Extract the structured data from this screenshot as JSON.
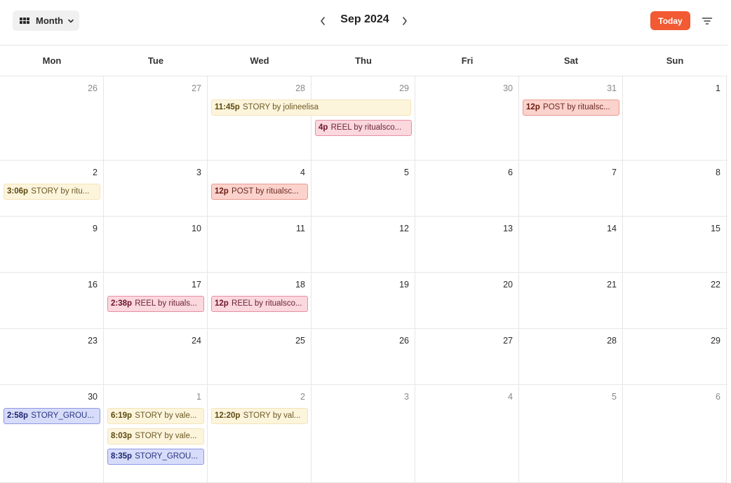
{
  "toolbar": {
    "view_label": "Month",
    "month_title": "Sep 2024",
    "today_label": "Today",
    "icons": {
      "view": "grid-icon",
      "view_dropdown": "chevron-down-icon",
      "prev": "chevron-left-icon",
      "next": "chevron-right-icon",
      "filter": "filter-icon"
    },
    "accent_color": "#f25a33"
  },
  "weekdays": [
    "Mon",
    "Tue",
    "Wed",
    "Thu",
    "Fri",
    "Sat",
    "Sun"
  ],
  "weeks": [
    {
      "days": [
        {
          "num": "26",
          "muted": true,
          "events": []
        },
        {
          "num": "27",
          "muted": true,
          "events": []
        },
        {
          "num": "28",
          "muted": true,
          "events": [
            {
              "time": "11:45p",
              "text": "STORY by jolineelisa",
              "kind": "story",
              "wide": true
            }
          ]
        },
        {
          "num": "29",
          "muted": true,
          "events": [
            {
              "time": "4p",
              "text": "REEL by ritualsco...",
              "kind": "reel"
            }
          ]
        },
        {
          "num": "30",
          "muted": true,
          "events": []
        },
        {
          "num": "31",
          "muted": true,
          "events": [
            {
              "time": "12p",
              "text": "POST by ritualsc...",
              "kind": "post"
            }
          ]
        },
        {
          "num": "1",
          "muted": false,
          "events": []
        }
      ]
    },
    {
      "days": [
        {
          "num": "2",
          "muted": false,
          "events": [
            {
              "time": "3:06p",
              "text": "STORY by ritu...",
              "kind": "story"
            }
          ]
        },
        {
          "num": "3",
          "muted": false,
          "events": []
        },
        {
          "num": "4",
          "muted": false,
          "events": [
            {
              "time": "12p",
              "text": "POST by ritualsc...",
              "kind": "post"
            }
          ]
        },
        {
          "num": "5",
          "muted": false,
          "events": []
        },
        {
          "num": "6",
          "muted": false,
          "events": []
        },
        {
          "num": "7",
          "muted": false,
          "events": []
        },
        {
          "num": "8",
          "muted": false,
          "events": []
        }
      ]
    },
    {
      "days": [
        {
          "num": "9",
          "muted": false,
          "events": []
        },
        {
          "num": "10",
          "muted": false,
          "events": []
        },
        {
          "num": "11",
          "muted": false,
          "events": []
        },
        {
          "num": "12",
          "muted": false,
          "events": []
        },
        {
          "num": "13",
          "muted": false,
          "events": []
        },
        {
          "num": "14",
          "muted": false,
          "events": []
        },
        {
          "num": "15",
          "muted": false,
          "events": []
        }
      ]
    },
    {
      "days": [
        {
          "num": "16",
          "muted": false,
          "events": []
        },
        {
          "num": "17",
          "muted": false,
          "events": [
            {
              "time": "2:38p",
              "text": "REEL by rituals...",
              "kind": "reel"
            }
          ]
        },
        {
          "num": "18",
          "muted": false,
          "events": [
            {
              "time": "12p",
              "text": "REEL by ritualsco...",
              "kind": "reel"
            }
          ]
        },
        {
          "num": "19",
          "muted": false,
          "events": []
        },
        {
          "num": "20",
          "muted": false,
          "events": []
        },
        {
          "num": "21",
          "muted": false,
          "events": []
        },
        {
          "num": "22",
          "muted": false,
          "events": []
        }
      ]
    },
    {
      "days": [
        {
          "num": "23",
          "muted": false,
          "events": []
        },
        {
          "num": "24",
          "muted": false,
          "events": []
        },
        {
          "num": "25",
          "muted": false,
          "events": []
        },
        {
          "num": "26",
          "muted": false,
          "events": []
        },
        {
          "num": "27",
          "muted": false,
          "events": []
        },
        {
          "num": "28",
          "muted": false,
          "events": []
        },
        {
          "num": "29",
          "muted": false,
          "events": []
        }
      ]
    },
    {
      "days": [
        {
          "num": "30",
          "muted": false,
          "events": [
            {
              "time": "2:58p",
              "text": "STORY_GROU...",
              "kind": "group"
            }
          ]
        },
        {
          "num": "1",
          "muted": true,
          "events": [
            {
              "time": "6:19p",
              "text": "STORY by vale...",
              "kind": "story"
            },
            {
              "time": "8:03p",
              "text": "STORY by vale...",
              "kind": "story"
            },
            {
              "time": "8:35p",
              "text": "STORY_GROU...",
              "kind": "group"
            }
          ]
        },
        {
          "num": "2",
          "muted": true,
          "events": [
            {
              "time": "12:20p",
              "text": "STORY by val...",
              "kind": "story"
            }
          ]
        },
        {
          "num": "3",
          "muted": true,
          "events": []
        },
        {
          "num": "4",
          "muted": true,
          "events": []
        },
        {
          "num": "5",
          "muted": true,
          "events": []
        },
        {
          "num": "6",
          "muted": true,
          "events": []
        }
      ]
    }
  ]
}
